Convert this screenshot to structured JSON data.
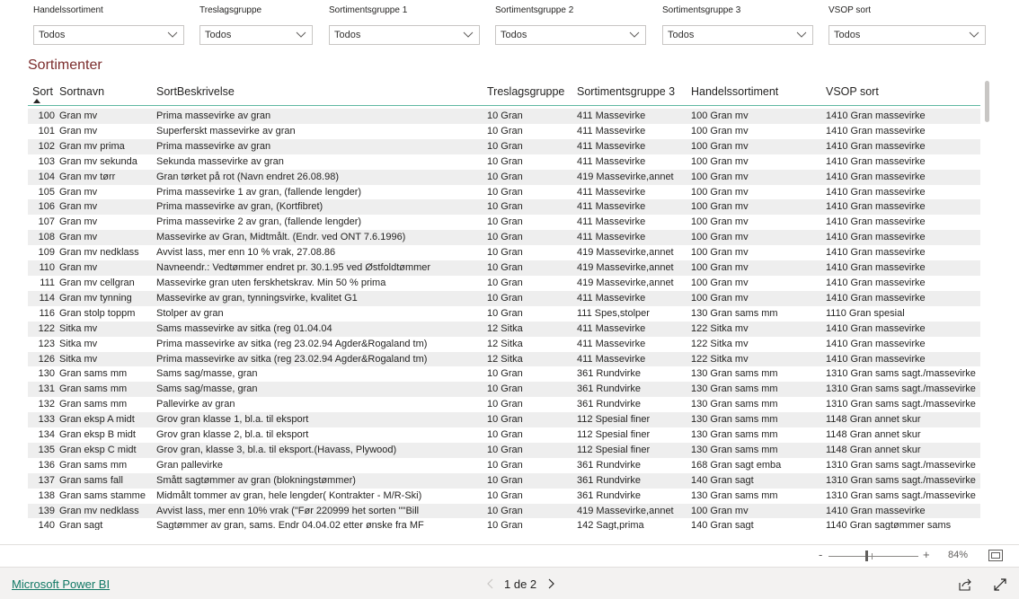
{
  "slicers": [
    {
      "label": "Handelssortiment",
      "value": "Todos"
    },
    {
      "label": "Treslagsgruppe",
      "value": "Todos"
    },
    {
      "label": "Sortimentsgruppe 1",
      "value": "Todos"
    },
    {
      "label": "Sortimentsgruppe 2",
      "value": "Todos"
    },
    {
      "label": "Sortimentsgruppe 3",
      "value": "Todos"
    },
    {
      "label": "VSOP sort",
      "value": "Todos"
    }
  ],
  "table": {
    "title": "Sortimenter",
    "columns": [
      "Sort",
      "Sortnavn",
      "SortBeskrivelse",
      "Treslagsgruppe",
      "Sortimentsgruppe 3",
      "Handelssortiment",
      "VSOP sort"
    ],
    "sorted_column": "Sort",
    "rows": [
      [
        "100",
        "Gran mv",
        "Prima massevirke av gran",
        "10 Gran",
        "411 Massevirke",
        "100 Gran mv",
        "1410 Gran massevirke"
      ],
      [
        "101",
        "Gran mv",
        "Superferskt massevirke av gran",
        "10 Gran",
        "411 Massevirke",
        "100 Gran mv",
        "1410 Gran massevirke"
      ],
      [
        "102",
        "Gran mv prima",
        "Prima massevirke av gran",
        "10 Gran",
        "411 Massevirke",
        "100 Gran mv",
        "1410 Gran massevirke"
      ],
      [
        "103",
        "Gran mv sekunda",
        "Sekunda massevirke av gran",
        "10 Gran",
        "411 Massevirke",
        "100 Gran mv",
        "1410 Gran massevirke"
      ],
      [
        "104",
        "Gran mv tørr",
        "Gran tørket på rot (Navn endret 26.08.98)",
        "10 Gran",
        "419 Massevirke,annet",
        "100 Gran mv",
        "1410 Gran massevirke"
      ],
      [
        "105",
        "Gran mv",
        "Prima massevirke 1 av gran, (fallende lengder)",
        "10 Gran",
        "411 Massevirke",
        "100 Gran mv",
        "1410 Gran massevirke"
      ],
      [
        "106",
        "Gran mv",
        "Prima massevirke av gran, (Kortfibret)",
        "10 Gran",
        "411 Massevirke",
        "100 Gran mv",
        "1410 Gran massevirke"
      ],
      [
        "107",
        "Gran mv",
        "Prima massevirke 2 av gran, (fallende lengder)",
        "10 Gran",
        "411 Massevirke",
        "100 Gran mv",
        "1410 Gran massevirke"
      ],
      [
        "108",
        "Gran mv",
        "Massevirke av Gran, Midtmålt. (Endr. ved ONT 7.6.1996)",
        "10 Gran",
        "411 Massevirke",
        "100 Gran mv",
        "1410 Gran massevirke"
      ],
      [
        "109",
        "Gran mv nedklass",
        "Avvist lass, mer enn 10 % vrak, 27.08.86",
        "10 Gran",
        "419 Massevirke,annet",
        "100 Gran mv",
        "1410 Gran massevirke"
      ],
      [
        "110",
        "Gran mv",
        "Navneendr.: Vedtømmer endret pr. 30.1.95 ved Østfoldtømmer",
        "10 Gran",
        "419 Massevirke,annet",
        "100 Gran mv",
        "1410 Gran massevirke"
      ],
      [
        "111",
        "Gran mv cellgran",
        "Massevirke gran uten ferskhetskrav. Min 50 % prima",
        "10 Gran",
        "419 Massevirke,annet",
        "100 Gran mv",
        "1410 Gran massevirke"
      ],
      [
        "114",
        "Gran mv tynning",
        "Massevirke av gran, tynningsvirke, kvalitet G1",
        "10 Gran",
        "411 Massevirke",
        "100 Gran mv",
        "1410 Gran massevirke"
      ],
      [
        "116",
        "Gran stolp toppm",
        "Stolper av gran",
        "10 Gran",
        "111 Spes,stolper",
        "130 Gran sams mm",
        "1110 Gran spesial"
      ],
      [
        "122",
        "Sitka mv",
        "Sams massevirke av sitka (reg 01.04.04",
        "12 Sitka",
        "411 Massevirke",
        "122 Sitka mv",
        "1410 Gran massevirke"
      ],
      [
        "123",
        "Sitka mv",
        "Prima massevirke av sitka (reg 23.02.94 Agder&Rogaland tm)",
        "12 Sitka",
        "411 Massevirke",
        "122 Sitka mv",
        "1410 Gran massevirke"
      ],
      [
        "126",
        "Sitka mv",
        "Prima massevirke av sitka (reg 23.02.94 Agder&Rogaland tm)",
        "12 Sitka",
        "411 Massevirke",
        "122 Sitka mv",
        "1410 Gran massevirke"
      ],
      [
        "130",
        "Gran sams mm",
        "Sams sag/masse, gran",
        "10 Gran",
        "361 Rundvirke",
        "130 Gran sams mm",
        "1310 Gran sams sagt./massevirke"
      ],
      [
        "131",
        "Gran sams mm",
        "Sams sag/masse, gran",
        "10 Gran",
        "361 Rundvirke",
        "130 Gran sams mm",
        "1310 Gran sams sagt./massevirke"
      ],
      [
        "132",
        "Gran sams mm",
        "Pallevirke av gran",
        "10 Gran",
        "361 Rundvirke",
        "130 Gran sams mm",
        "1310 Gran sams sagt./massevirke"
      ],
      [
        "133",
        "Gran eksp A midt",
        "Grov gran klasse 1, bl.a. til eksport",
        "10 Gran",
        "112 Spesial finer",
        "130 Gran sams mm",
        "1148 Gran annet skur"
      ],
      [
        "134",
        "Gran eksp B midt",
        "Grov gran klasse 2, bl.a. til eksport",
        "10 Gran",
        "112 Spesial finer",
        "130 Gran sams mm",
        "1148 Gran annet skur"
      ],
      [
        "135",
        "Gran eksp C midt",
        "Grov gran, klasse 3, bl.a. til eksport.(Havass, Plywood)",
        "10 Gran",
        "112 Spesial finer",
        "130 Gran sams mm",
        "1148 Gran annet skur"
      ],
      [
        "136",
        "Gran sams mm",
        "Gran pallevirke",
        "10 Gran",
        "361 Rundvirke",
        "168 Gran sagt emba",
        "1310 Gran sams sagt./massevirke"
      ],
      [
        "137",
        "Gran sams fall",
        "Smått sagtømmer av gran (blokningstømmer)",
        "10 Gran",
        "361 Rundvirke",
        "140 Gran sagt",
        "1310 Gran sams sagt./massevirke"
      ],
      [
        "138",
        "Gran sams stamme",
        "Midmålt tommer av gran, hele lengder( Kontrakter - M/R-Ski)",
        "10 Gran",
        "361 Rundvirke",
        "130 Gran sams mm",
        "1310 Gran sams sagt./massevirke"
      ],
      [
        "139",
        "Gran mv nedklass",
        "Avvist lass, mer enn 10% vrak (\"Før 220999 het sorten \"\"Bill",
        "10 Gran",
        "419 Massevirke,annet",
        "100 Gran mv",
        "1410 Gran massevirke"
      ],
      [
        "140",
        "Gran sagt",
        "Sagtømmer av gran, sams. Endr 04.04.02 etter ønske fra MF",
        "10 Gran",
        "142 Sagt,prima",
        "140 Gran sagt",
        "1140 Gran sagtømmer sams"
      ]
    ]
  },
  "zoom": {
    "minus": "-",
    "plus": "+",
    "level": "84%",
    "value_fraction": 0.42
  },
  "footer": {
    "brand_link": "Microsoft Power BI",
    "page_label": "1 de 2"
  },
  "icons": {
    "dropdown": "chevron-down-icon",
    "sort": "sort-ascending-icon",
    "fit": "fit-to-page-icon",
    "prev": "chevron-left-icon",
    "next": "chevron-right-icon",
    "share": "share-icon",
    "expand": "fullscreen-icon"
  },
  "colors": {
    "title": "#7b2d2d",
    "header_rule": "#5fb8a2",
    "link": "#117865",
    "stripe": "#eeeeee"
  }
}
